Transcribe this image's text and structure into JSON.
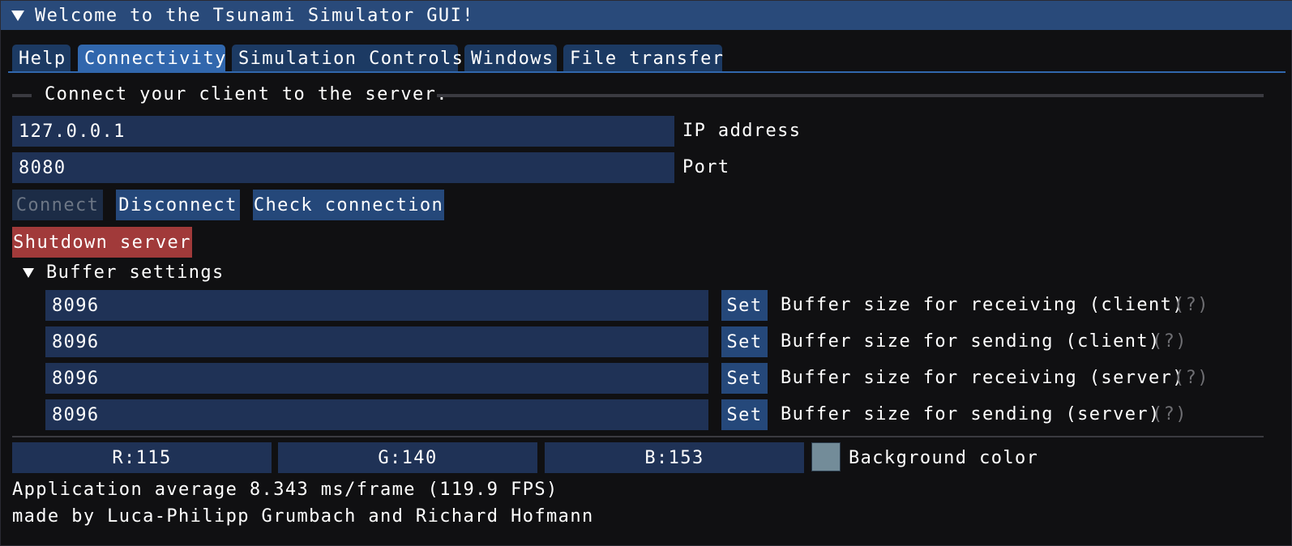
{
  "window": {
    "title": "Welcome to the Tsunami Simulator GUI!"
  },
  "tabs": [
    {
      "label": "Help",
      "active": false
    },
    {
      "label": "Connectivity",
      "active": true
    },
    {
      "label": "Simulation Controls",
      "active": false
    },
    {
      "label": "Windows",
      "active": false
    },
    {
      "label": "File transfer",
      "active": false
    }
  ],
  "connectivity": {
    "section_heading": "Connect your client to the server.",
    "ip": {
      "value": "127.0.0.1",
      "label": "IP address"
    },
    "port": {
      "value": "8080",
      "label": "Port"
    },
    "connect_label": "Connect",
    "disconnect_label": "Disconnect",
    "check_label": "Check connection",
    "shutdown_label": "Shutdown server"
  },
  "buffer": {
    "heading": "Buffer settings",
    "set_label": "Set",
    "help_marker": "(?)",
    "rows": [
      {
        "value": "8096",
        "label": "Buffer size for receiving (client)"
      },
      {
        "value": "8096",
        "label": "Buffer size for sending (client)"
      },
      {
        "value": "8096",
        "label": "Buffer size for receiving (server)"
      },
      {
        "value": "8096",
        "label": "Buffer size for sending (server)"
      }
    ]
  },
  "background": {
    "r": "R:115",
    "g": "G:140",
    "b": "B:153",
    "label": "Background color",
    "swatch_color": "#738c99"
  },
  "status": {
    "fps": "Application average 8.343 ms/frame (119.9 FPS)",
    "credits": "made by Luca-Philipp Grumbach and Richard Hofmann"
  },
  "colors": {
    "title_bar": "#294a7a",
    "tab_active": "#3167ad",
    "tab_inactive": "#1c3a63",
    "field_bg": "#1f3256",
    "button": "#25487a",
    "danger_button": "#a13a3a"
  }
}
